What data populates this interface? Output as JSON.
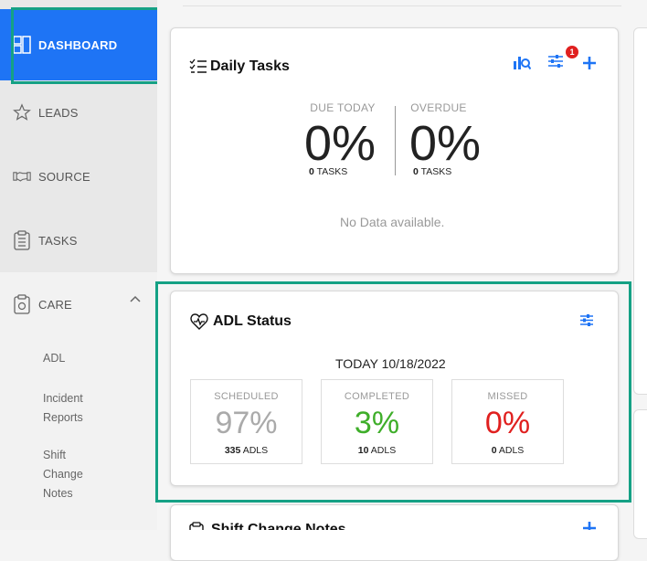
{
  "sidebar": {
    "items": [
      {
        "label": "DASHBOARD",
        "icon": "dashboard-icon"
      },
      {
        "label": "LEADS",
        "icon": "star-icon"
      },
      {
        "label": "SOURCE",
        "icon": "handshake-icon"
      },
      {
        "label": "TASKS",
        "icon": "clipboard-list-icon"
      },
      {
        "label": "CARE",
        "icon": "care-clipboard-icon"
      }
    ],
    "care_subitems": [
      "ADL",
      "Incident",
      "Reports",
      "Shift",
      "Change",
      "Notes"
    ]
  },
  "daily_tasks": {
    "title": "Daily Tasks",
    "due_today": {
      "label": "DUE TODAY",
      "percent": "0%",
      "count": "0",
      "unit": "TASKS"
    },
    "overdue": {
      "label": "OVERDUE",
      "percent": "0%",
      "count": "0",
      "unit": "TASKS"
    },
    "empty_message": "No Data available.",
    "filter_badge": "1"
  },
  "adl_status": {
    "title": "ADL Status",
    "date": "TODAY 10/18/2022",
    "scheduled": {
      "label": "SCHEDULED",
      "percent": "97%",
      "count": "335",
      "unit": "ADLS",
      "color": "#aaaaaa"
    },
    "completed": {
      "label": "COMPLETED",
      "percent": "3%",
      "count": "10",
      "unit": "ADLS",
      "color": "#3fae2a"
    },
    "missed": {
      "label": "MISSED",
      "percent": "0%",
      "count": "0",
      "unit": "ADLS",
      "color": "#e0201f"
    }
  },
  "shift_change": {
    "title": "Shift Change Notes"
  },
  "colors": {
    "accent": "#1e74f5",
    "highlight_outline": "#15a185"
  }
}
